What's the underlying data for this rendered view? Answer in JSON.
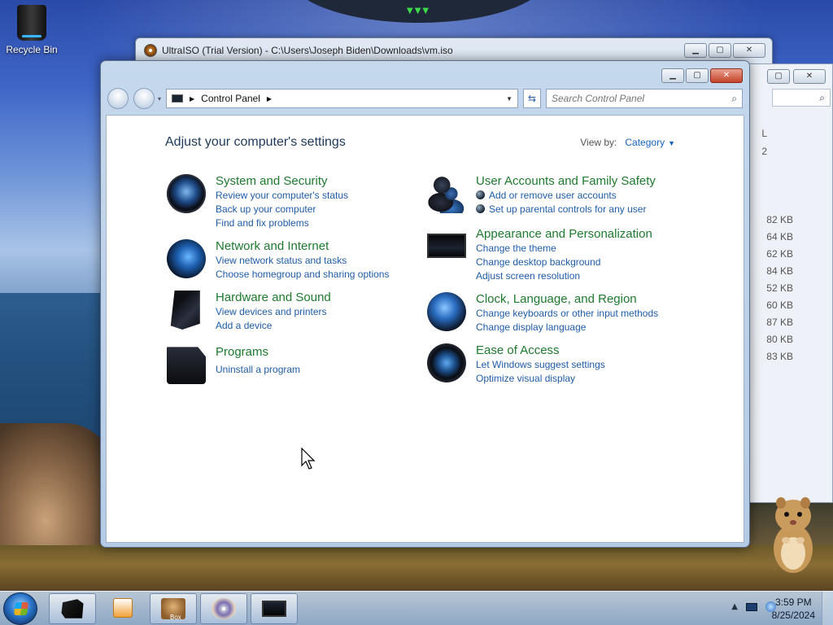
{
  "desktop": {
    "recycle_bin_label": "Recycle Bin"
  },
  "ultraiso_window": {
    "title": "UltraISO (Trial Version) - C:\\Users\\Joseph Biden\\Downloads\\vm.iso"
  },
  "explorer_strip": {
    "column_header": "L",
    "first_value": "2",
    "sizes": [
      "82 KB",
      "64 KB",
      "62 KB",
      "84 KB",
      "52 KB",
      "60 KB",
      "87 KB",
      "80 KB",
      "83 KB"
    ]
  },
  "control_panel": {
    "breadcrumb": "Control Panel",
    "search_placeholder": "Search Control Panel",
    "heading": "Adjust your computer's settings",
    "view_by_label": "View by:",
    "view_by_value": "Category",
    "categories_left": [
      {
        "title": "System and Security",
        "links": [
          "Review your computer's status",
          "Back up your computer",
          "Find and fix problems"
        ],
        "icon": "security-shield-icon"
      },
      {
        "title": "Network and Internet",
        "links": [
          "View network status and tasks",
          "Choose homegroup and sharing options"
        ],
        "icon": "network-globe-icon"
      },
      {
        "title": "Hardware and Sound",
        "links": [
          "View devices and printers",
          "Add a device"
        ],
        "icon": "printer-speaker-icon"
      },
      {
        "title": "Programs",
        "links": [
          "Uninstall a program"
        ],
        "icon": "programs-icon"
      }
    ],
    "categories_right": [
      {
        "title": "User Accounts and Family Safety",
        "links": [
          "Add or remove user accounts",
          "Set up parental controls for any user"
        ],
        "icon": "users-icon"
      },
      {
        "title": "Appearance and Personalization",
        "links": [
          "Change the theme",
          "Change desktop background",
          "Adjust screen resolution"
        ],
        "icon": "monitor-icon"
      },
      {
        "title": "Clock, Language, and Region",
        "links": [
          "Change keyboards or other input methods",
          "Change display language"
        ],
        "icon": "clock-globe-icon"
      },
      {
        "title": "Ease of Access",
        "links": [
          "Let Windows suggest settings",
          "Optimize visual display"
        ],
        "icon": "ease-of-access-icon"
      }
    ]
  },
  "taskbar": {
    "time": "3:59 PM",
    "date": "8/25/2024",
    "box_label": "Box"
  },
  "colors": {
    "category_title": "#1e7a2e",
    "link": "#1f5ca8",
    "heading": "#1e395b"
  }
}
